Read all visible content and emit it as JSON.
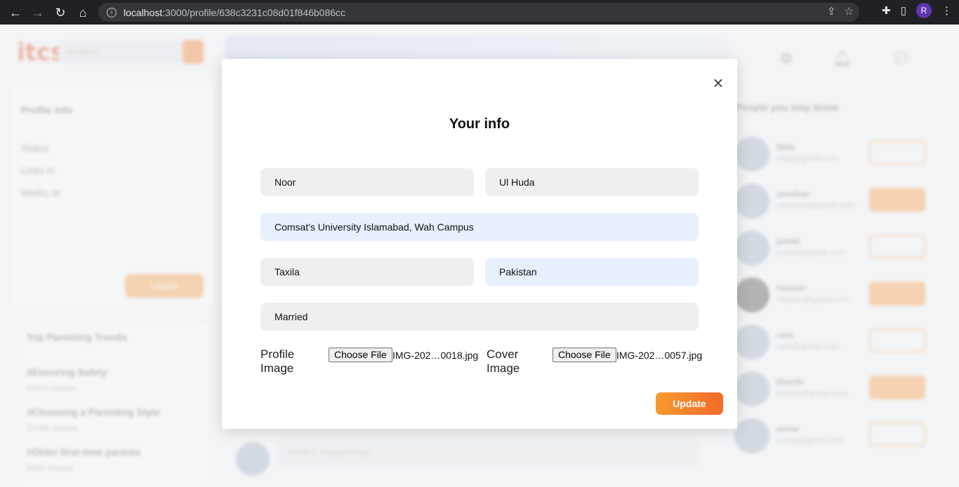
{
  "browser": {
    "url_host": "localhost",
    "url_path": ":3000/profile/638c3231c08d01f846b086cc",
    "profile_initial": "R"
  },
  "background": {
    "logo": "itcs",
    "search_placeholder": "#Explore",
    "profile_info_title": "Profile Info",
    "profile_rows": [
      "Status",
      "Lives in",
      "Works at"
    ],
    "logout_label": "Logout",
    "trends_title": "Top Parenting Trends",
    "trends": [
      {
        "tag": "#Ensuring Safety",
        "shares": "144% shares"
      },
      {
        "tag": "#Choosing a Parenting Style",
        "shares": "1230k shares"
      },
      {
        "tag": "#Older first-time parents",
        "shares": "965k shares"
      }
    ],
    "people_title": "People you may know",
    "people": [
      {
        "name": "Nida",
        "email": "nida@gmail.com",
        "action": "Unfollow"
      },
      {
        "name": "zeeshan",
        "email": "zeeshan@gmail.com",
        "action": "Follow"
      },
      {
        "name": "jawad",
        "email": "jawad@gmail.com",
        "action": "Unfollow"
      },
      {
        "name": "hassan",
        "email": "hassan@gmail.com",
        "action": "Follow"
      },
      {
        "name": "sam",
        "email": "sam@gmail.com",
        "action": "Unfollow"
      },
      {
        "name": "khushi",
        "email": "khushi@gmail.com",
        "action": "Follow"
      },
      {
        "name": "amna",
        "email": "amna@gmail.com",
        "action": "Unfollow"
      }
    ],
    "composer_placeholder": "what's happening"
  },
  "modal": {
    "title": "Your info",
    "first_name": "Noor",
    "last_name": "Ul Huda",
    "works_at": "Comsat's University Islamabad, Wah Campus",
    "lives_in": "Taxila",
    "country": "Pakistan",
    "relationship": "Married",
    "profile_image_label": "Profile Image",
    "cover_image_label": "Cover Image",
    "choose_file_label": "Choose File",
    "profile_file_name": "IMG-202…0018.jpg",
    "cover_file_name": "IMG-202…0057.jpg",
    "update_label": "Update"
  }
}
